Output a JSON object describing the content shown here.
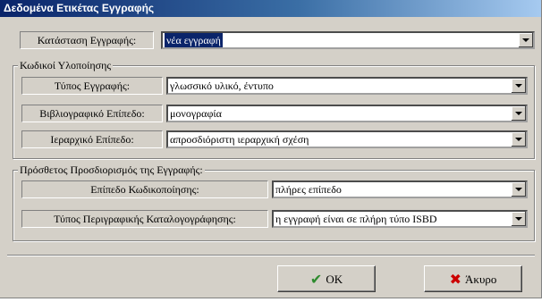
{
  "window": {
    "title": "Δεδομένα Ετικέτας Εγγραφής"
  },
  "top_row": {
    "label": "Κατάσταση Εγγραφής:",
    "value": "νέα εγγραφή"
  },
  "coded_group": {
    "title": "Κωδικοί Υλοποίησης",
    "rows": [
      {
        "label": "Τύπος Εγγραφής:",
        "value": "γλωσσικό υλικό, έντυπο"
      },
      {
        "label": "Βιβλιογραφικό Επίπεδο:",
        "value": "μονογραφία"
      },
      {
        "label": "Ιεραρχικό Επίπεδο:",
        "value": "απροσδιόριστη ιεραρχική σχέση"
      }
    ]
  },
  "extra_group": {
    "title": "Πρόσθετος Προσδιορισμός της Εγγραφής:",
    "rows": [
      {
        "label": "Επίπεδο Κωδικοποίησης:",
        "value": "πλήρες επίπεδο"
      },
      {
        "label": "Τύπος Περιγραφικής Καταλογογράφησης:",
        "value": "η εγγραφή είναι σε πλήρη τύπο ISBD"
      }
    ]
  },
  "buttons": {
    "ok_label": "OK",
    "ok_icon": "✔",
    "ok_icon_color": "#2e8b2e",
    "cancel_label": "Άκυρο",
    "cancel_icon": "✖",
    "cancel_icon_color": "#cc0000"
  }
}
